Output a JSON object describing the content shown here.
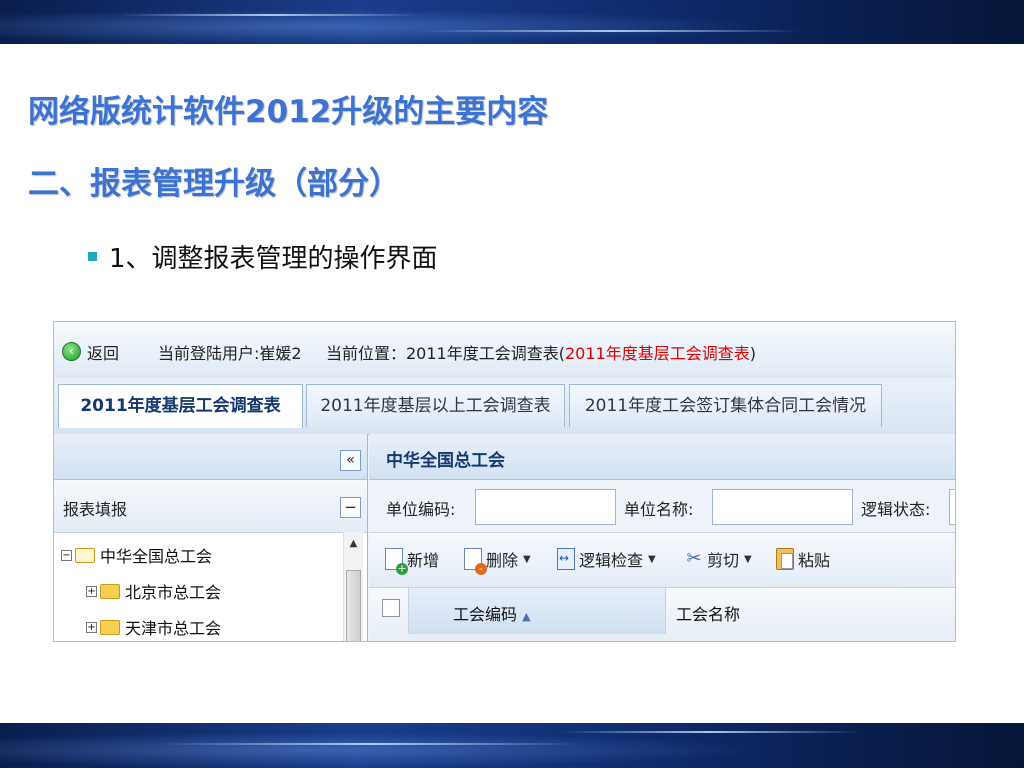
{
  "slide": {
    "title_line1": "网络版统计软件2012升级的主要内容",
    "title_line2": "二、报表管理升级（部分）",
    "bullet": "1、调整报表管理的操作界面"
  },
  "app": {
    "topbar": {
      "back_label": "返回",
      "current_user": "当前登陆用户:崔媛2",
      "location_prefix": "当前位置：2011年度工会调查表(",
      "location_highlight": "2011年度基层工会调查表",
      "location_suffix": ")"
    },
    "tabs": [
      {
        "label": "2011年度基层工会调查表",
        "active": true
      },
      {
        "label": "2011年度基层以上工会调查表",
        "active": false
      },
      {
        "label": "2011年度工会签订集体合同工会情况",
        "active": false
      }
    ],
    "left_panel": {
      "collapse_glyph": "«",
      "section_label": "报表填报",
      "section_toggle": "−",
      "tree": [
        {
          "label": "中华全国总工会",
          "level": 0,
          "toggle": "−"
        },
        {
          "label": "北京市总工会",
          "level": 1,
          "toggle": "+"
        },
        {
          "label": "天津市总工会",
          "level": 1,
          "toggle": "+"
        }
      ]
    },
    "right_panel": {
      "title": "中华全国总工会",
      "filters": {
        "unit_code_label": "单位编码:",
        "unit_code_value": "",
        "unit_name_label": "单位名称:",
        "unit_name_value": "",
        "logic_status_label": "逻辑状态:"
      },
      "toolbar": {
        "add": "新增",
        "delete": "删除",
        "logic_check": "逻辑检查",
        "cut": "剪切",
        "paste": "粘贴"
      },
      "grid": {
        "columns": [
          "工会编码",
          "工会名称"
        ],
        "sort_glyph": "▲"
      }
    }
  },
  "colors": {
    "title_blue": "#3b73d4",
    "bullet_teal": "#22a7b9",
    "location_red": "#e00000"
  }
}
